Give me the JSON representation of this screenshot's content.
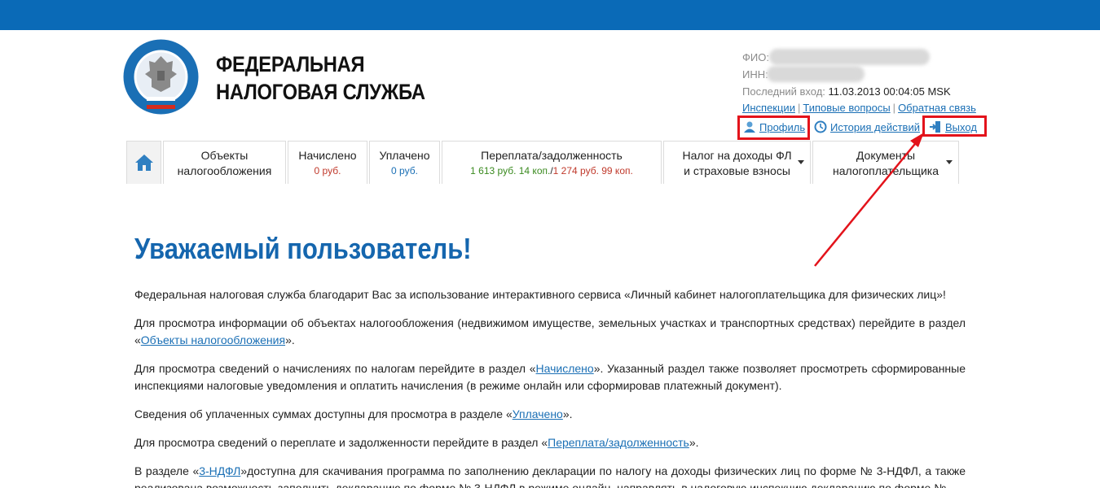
{
  "header": {
    "brand_line1": "ФЕДЕРАЛЬНАЯ",
    "brand_line2": "НАЛОГОВАЯ СЛУЖБА",
    "logo_ring_text": "ФЕДЕРАЛЬНАЯ НАЛОГОВАЯ СЛУЖБА"
  },
  "user": {
    "fio_label": "ФИО:",
    "inn_label": "ИНН:",
    "last_login_label": "Последний вход:",
    "last_login_value": "11.03.2013 00:04:05 MSK"
  },
  "top_links": [
    {
      "label": "Инспекции"
    },
    {
      "label": "Типовые вопросы"
    },
    {
      "label": "Обратная связь"
    }
  ],
  "actions": {
    "profile": "Профиль",
    "history": "История действий",
    "logout": "Выход"
  },
  "tabs": {
    "objects": {
      "line1": "Объекты",
      "line2": "налогообложения"
    },
    "accrued": {
      "label": "Начислено",
      "value": "0 руб."
    },
    "paid": {
      "label": "Уплачено",
      "value": "0 руб."
    },
    "overpay": {
      "label": "Переплата/задолженность",
      "over_value": "1 613 руб. 14 коп.",
      "sep": "/",
      "debt_value": "1 274 руб. 99 коп."
    },
    "ndfl": {
      "line1": "Налог на доходы ФЛ",
      "line2": "и страховые взносы"
    },
    "docs": {
      "line1": "Документы",
      "line2": "налогоплательщика"
    }
  },
  "main": {
    "title": "Уважаемый пользователь!",
    "p1": "Федеральная налоговая служба благодарит Вас за использование интерактивного сервиса «Личный кабинет налогоплательщика для физических лиц»!",
    "p2_pre": "Для просмотра информации об объектах налогообложения (недвижимом имуществе, земельных участках и транспортных средствах) перейдите в раздел «",
    "p2_link": "Объекты налогообложения",
    "p2_post": "».",
    "p3_pre": "Для просмотра сведений о начислениях по налогам перейдите в раздел «",
    "p3_link": "Начислено",
    "p3_post": "». Указанный раздел также позволяет просмотреть сформированные инспекциями налоговые уведомления и оплатить начисления (в режиме онлайн или сформировав платежный документ).",
    "p4_pre": "Сведения об уплаченных суммах доступны для просмотра в разделе «",
    "p4_link": "Уплачено",
    "p4_post": "».",
    "p5_pre": "Для просмотра сведений о переплате и задолженности перейдите в раздел «",
    "p5_link": "Переплата/задолженность",
    "p5_post": "».",
    "p6_pre": "В разделе «",
    "p6_link": "3-НДФЛ",
    "p6_post": "»доступна для скачивания программа по заполнению декларации по налогу на доходы физических лиц по форме № 3-НДФЛ, а также реализована возможность заполнить декларацию по форме № 3-НДФЛ в режиме онлайн, направлять в налоговую инспекцию декларацию по форме №"
  },
  "colors": {
    "topbar": "#0a6ab7",
    "title": "#1566ae",
    "link": "#1a6fb5",
    "highlight": "#e3131b"
  }
}
